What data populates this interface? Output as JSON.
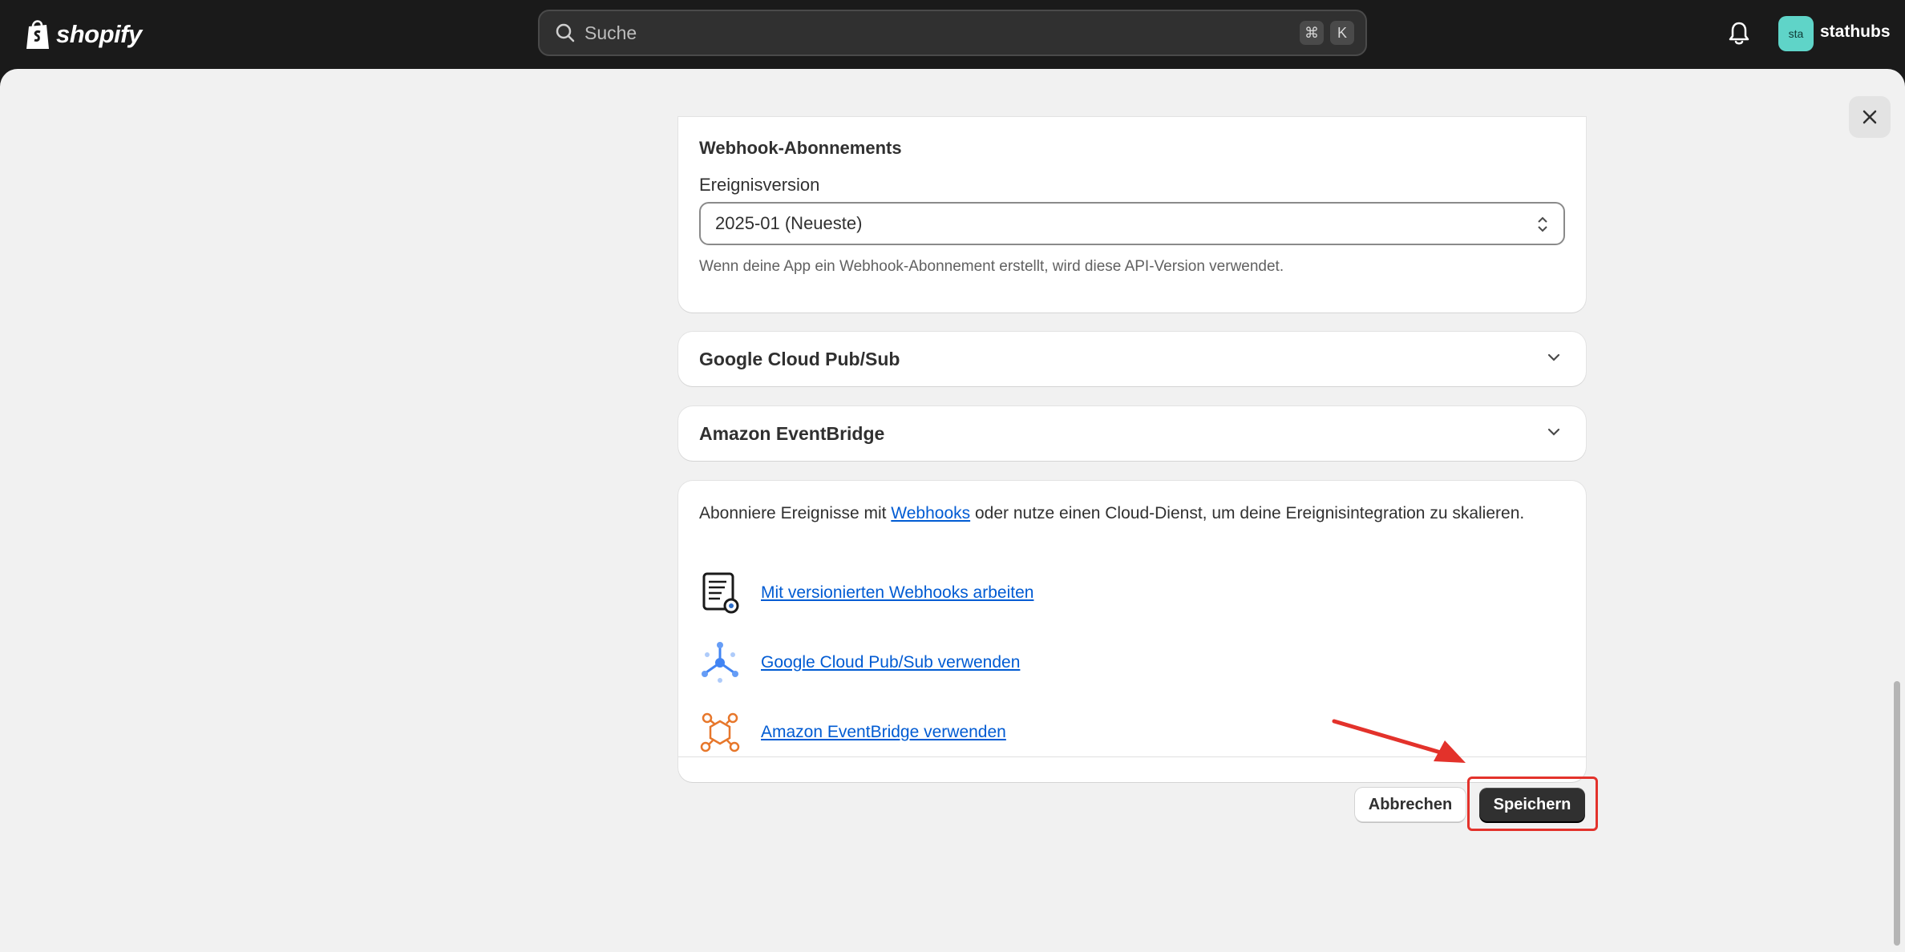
{
  "topbar": {
    "brand": "shopify",
    "search_placeholder": "Suche",
    "shortcut_keys": [
      "⌘",
      "K"
    ],
    "avatar_initials": "sta",
    "store_name": "stathubs"
  },
  "webhook_card": {
    "title": "Webhook-Abonnements",
    "event_version_label": "Ereignisversion",
    "event_version_value": "2025-01 (Neueste)",
    "help_text": "Wenn deine App ein Webhook-Abonnement erstellt, wird diese API-Version verwendet."
  },
  "accordions": [
    {
      "title": "Google Cloud Pub/Sub"
    },
    {
      "title": "Amazon EventBridge"
    }
  ],
  "resources": {
    "intro_before": "Abonniere Ereignisse mit ",
    "intro_link": "Webhooks",
    "intro_after": " oder nutze einen Cloud-Dienst, um deine Ereignisintegration zu skalieren.",
    "links": [
      {
        "label": "Mit versionierten Webhooks arbeiten",
        "icon": "scroll-document-icon"
      },
      {
        "label": "Google Cloud Pub/Sub verwenden",
        "icon": "google-pubsub-icon"
      },
      {
        "label": "Amazon EventBridge verwenden",
        "icon": "eventbridge-icon"
      }
    ]
  },
  "actions": {
    "cancel_label": "Abbrechen",
    "save_label": "Speichern"
  },
  "colors": {
    "link": "#005bd3",
    "primary_button": "#303030",
    "annotation": "#e3322b",
    "topbar": "#1a1a1a"
  }
}
